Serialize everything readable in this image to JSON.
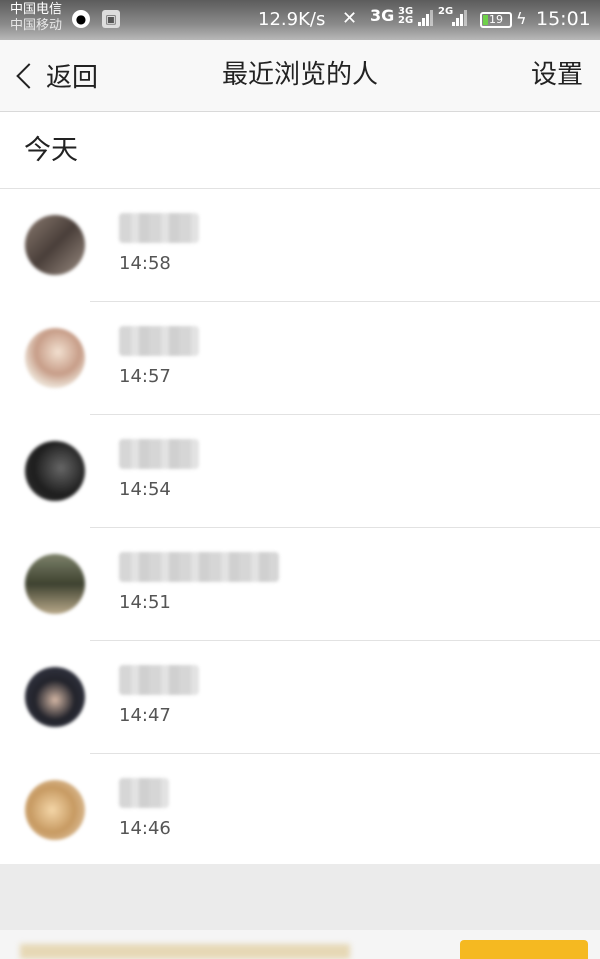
{
  "status_bar": {
    "carrier_1": "中国电信",
    "carrier_2": "中国移动",
    "speed": "12.9K/s",
    "network_1": "3G",
    "network_2_top": "3G",
    "network_2_bottom": "2G",
    "network_3": "2G",
    "battery": "19",
    "time": "15:01"
  },
  "nav": {
    "back_label": "返回",
    "title": "最近浏览的人",
    "settings_label": "设置"
  },
  "section": {
    "header": "今天"
  },
  "visitors": [
    {
      "name": "",
      "time": "14:58",
      "avatar_color": "#6f5f5a",
      "name_width": "blurred"
    },
    {
      "name": "",
      "time": "14:57",
      "avatar_color": "#d8b8a0",
      "name_width": "blurred"
    },
    {
      "name": "",
      "time": "14:54",
      "avatar_color": "#2a2a2a",
      "name_width": "blurred"
    },
    {
      "name": "",
      "time": "14:51",
      "avatar_color": "#4f5443",
      "name_width": "blurred"
    },
    {
      "name": "",
      "time": "14:47",
      "avatar_color": "#2b2d36",
      "name_width": "blurred"
    },
    {
      "name": "",
      "time": "14:46",
      "avatar_color": "#d5b07a",
      "name_width": "blurred"
    }
  ],
  "colors": {
    "accent_footer": "#f5b921",
    "battery_fill": "#6fd14a"
  }
}
